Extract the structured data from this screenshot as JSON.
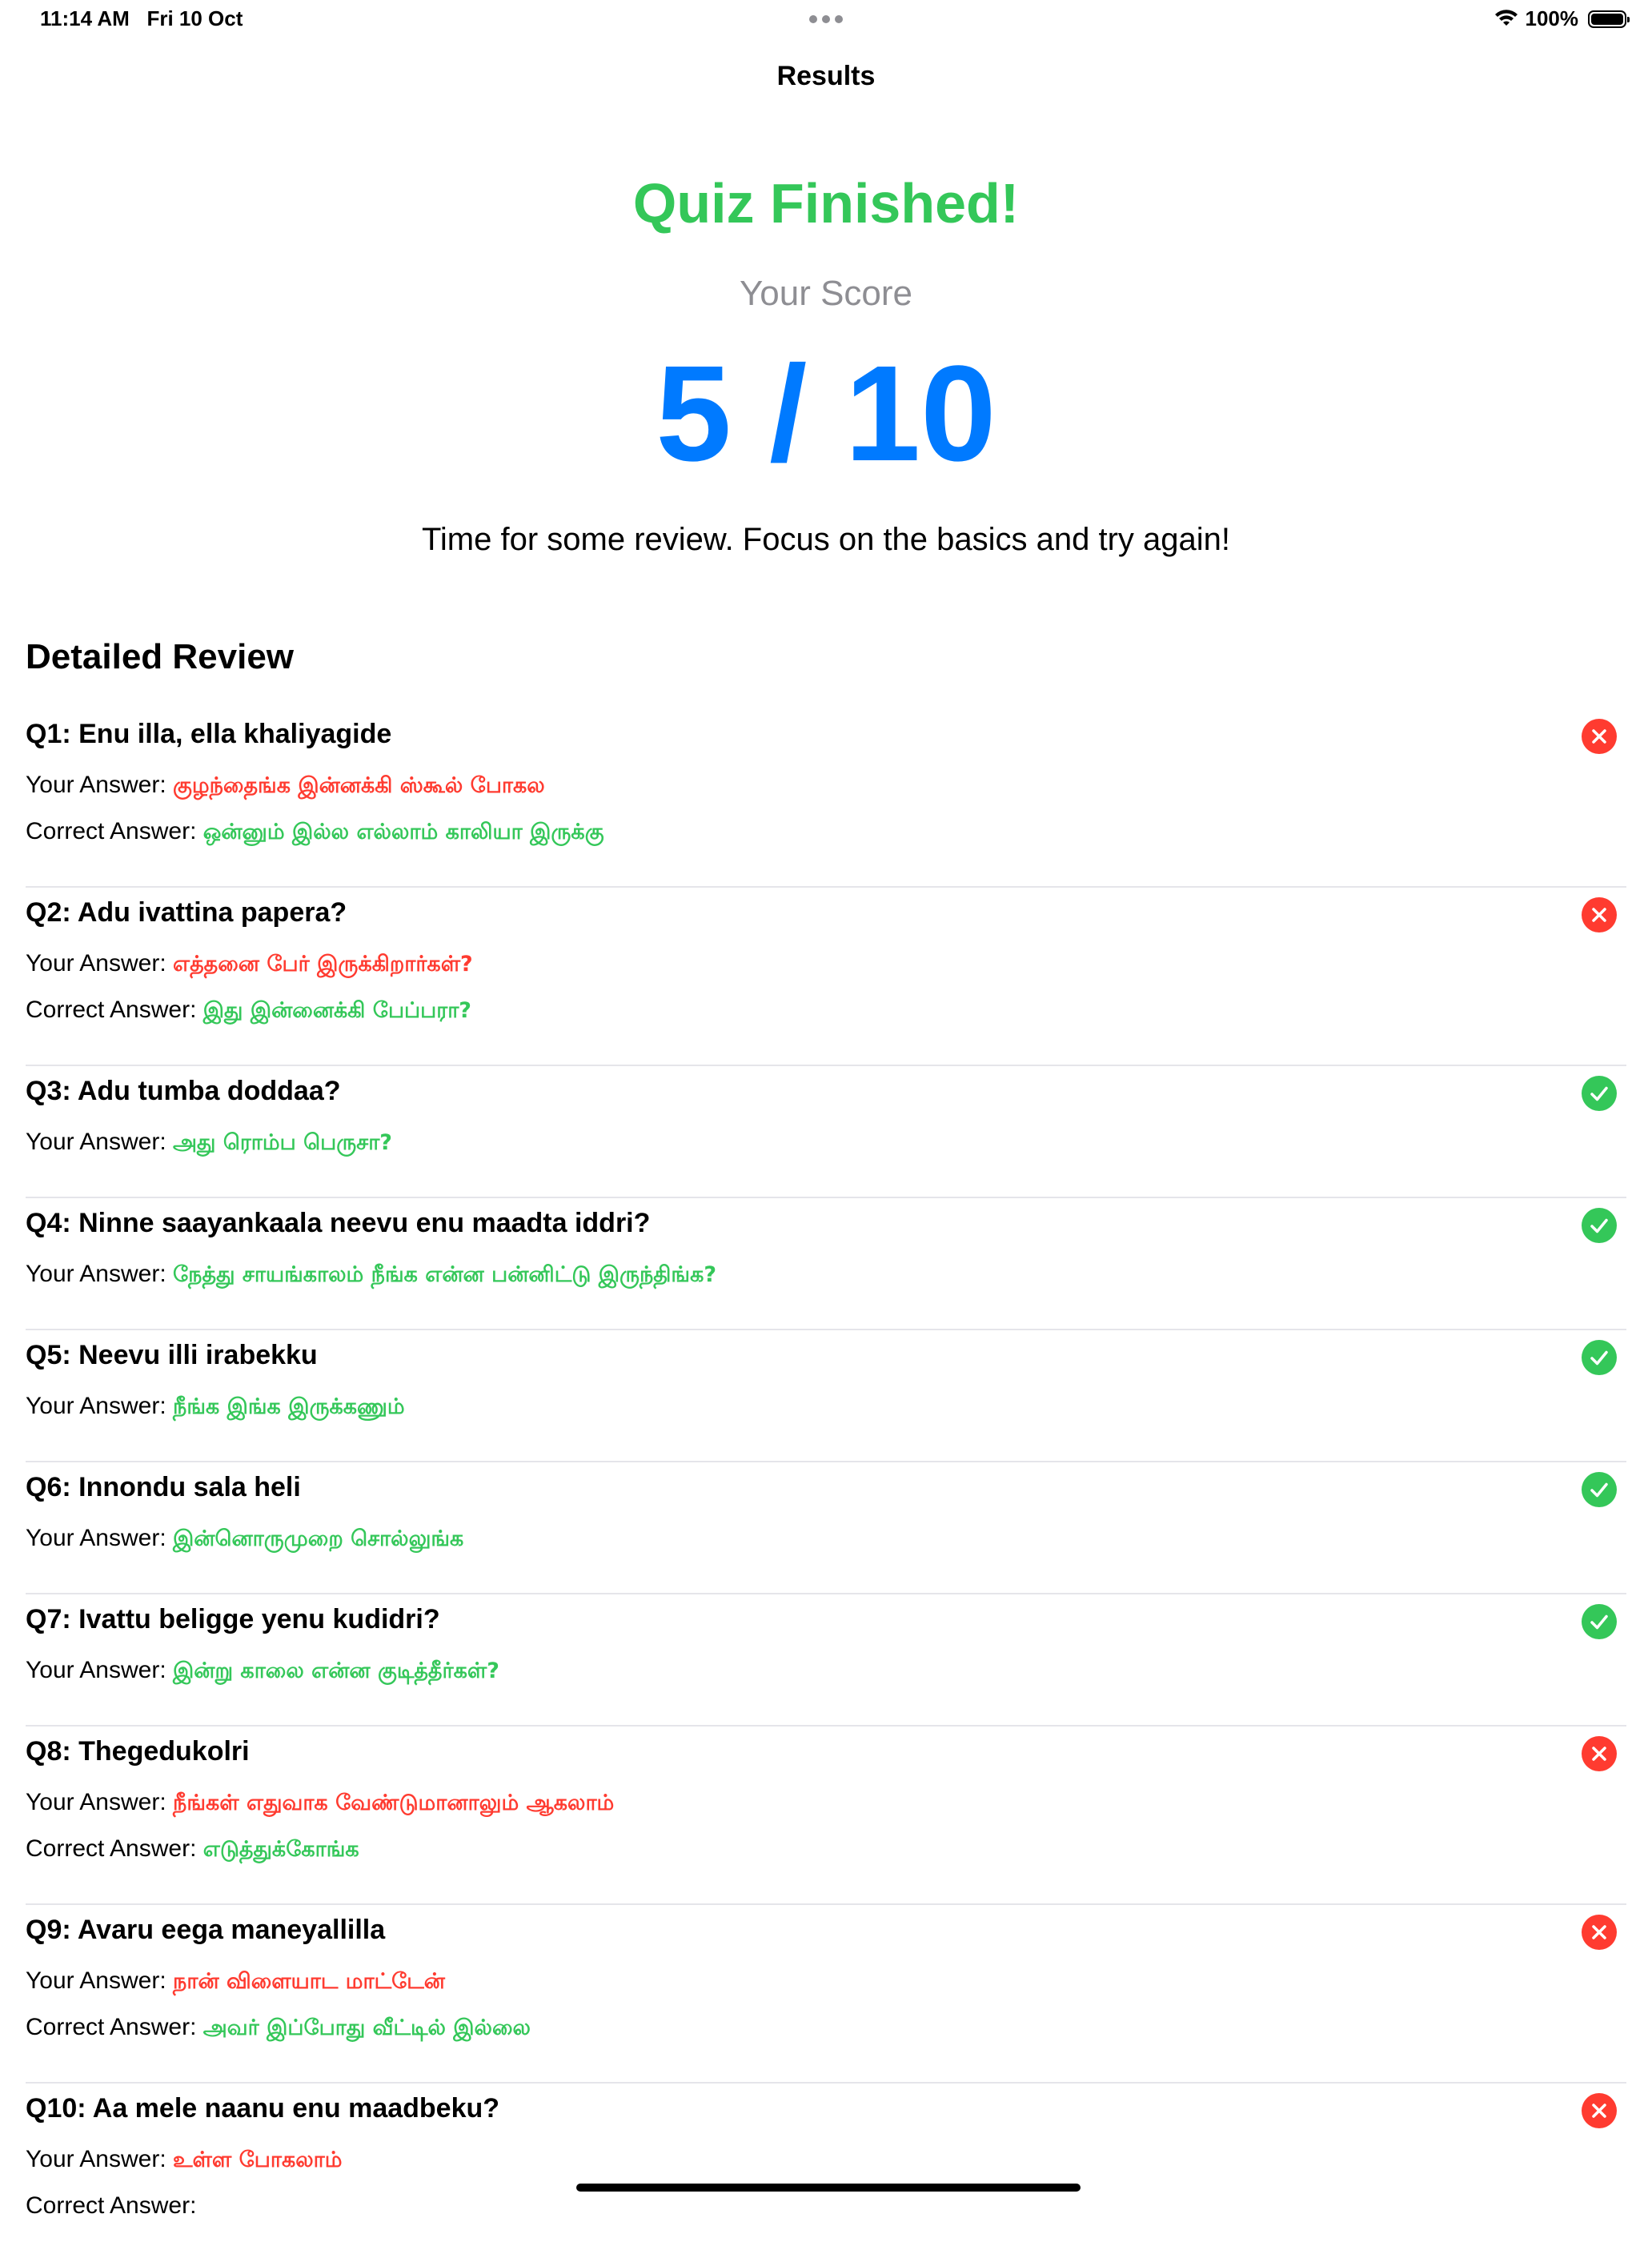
{
  "status_bar": {
    "time": "11:14 AM",
    "date": "Fri 10 Oct",
    "battery": "100%"
  },
  "nav": {
    "title": "Results"
  },
  "summary": {
    "title": "Quiz Finished!",
    "score_label": "Your Score",
    "score": "5 / 10",
    "message": "Time for some review. Focus on the basics and try again!"
  },
  "review": {
    "heading": "Detailed Review",
    "your_answer_label": "Your Answer:",
    "correct_answer_label": "Correct Answer:",
    "items": [
      {
        "question": "Q1: Enu illa, ella khaliyagide",
        "your_answer": "குழந்தைங்க இன்னக்கி ஸ்கூல் போகல",
        "correct_answer": "ஒன்னும் இல்ல எல்லாம் காலியா இருக்கு",
        "status": "wrong"
      },
      {
        "question": "Q2: Adu ivattina papera?",
        "your_answer": "எத்தனை பேர் இருக்கிறார்கள்?",
        "correct_answer": "இது இன்னைக்கி பேப்பரா?",
        "status": "wrong"
      },
      {
        "question": "Q3: Adu tumba doddaa?",
        "your_answer": "அது ரொம்ப பெருசா?",
        "status": "correct"
      },
      {
        "question": "Q4: Ninne saayankaala neevu enu maadta iddri?",
        "your_answer": "நேத்து சாயங்காலம் நீங்க என்ன பன்னிட்டு இருந்திங்க?",
        "status": "correct"
      },
      {
        "question": "Q5: Neevu illi irabekku",
        "your_answer": "நீங்க இங்க இருக்கணும்",
        "status": "correct"
      },
      {
        "question": "Q6: Innondu sala heli",
        "your_answer": "இன்னொருமுறை சொல்லுங்க",
        "status": "correct"
      },
      {
        "question": "Q7: Ivattu beligge yenu kudidri?",
        "your_answer": "இன்று காலை என்ன குடித்தீர்கள்?",
        "status": "correct"
      },
      {
        "question": "Q8: Thegedukolri",
        "your_answer": "நீங்கள் எதுவாக வேண்டுமானாலும் ஆகலாம்",
        "correct_answer": "எடுத்துக்கோங்க",
        "status": "wrong"
      },
      {
        "question": "Q9: Avaru eega maneyallilla",
        "your_answer": "நான் விளையாட மாட்டேன்",
        "correct_answer": "அவர் இப்போது வீட்டில் இல்லை",
        "status": "wrong"
      },
      {
        "question": "Q10: Aa mele naanu enu maadbeku?",
        "your_answer": "உள்ள போகலாம்",
        "status": "wrong"
      }
    ]
  },
  "colors": {
    "success": "#34c759",
    "error": "#ff3b30",
    "accent": "#007aff",
    "secondary_text": "#8e8e93",
    "divider": "#e5e5ea"
  },
  "icons": {
    "correct": "checkmark-circle-icon",
    "wrong": "xmark-circle-icon",
    "wifi": "wifi-icon",
    "battery": "battery-icon",
    "multitasking": "ellipsis-icon"
  }
}
